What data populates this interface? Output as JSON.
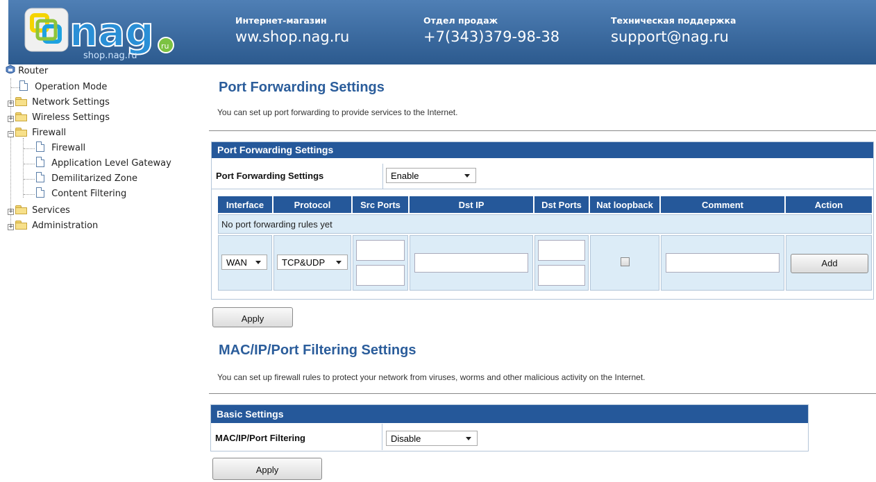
{
  "header": {
    "logo_text": "nag",
    "logo_sub": "shop.nag.ru",
    "logo_badge": "ru",
    "shop_label": "Интернет-магазин",
    "shop_value": "ww.shop.nag.ru",
    "sales_label": "Отдел продаж",
    "sales_value": "+7(343)379-98-38",
    "support_label": "Техническая поддержка",
    "support_value": "support@nag.ru"
  },
  "tree": {
    "root": "Router",
    "operation_mode": "Operation Mode",
    "network_settings": "Network Settings",
    "wireless_settings": "Wireless Settings",
    "firewall": "Firewall",
    "firewall_child": "Firewall",
    "alg": "Application Level Gateway",
    "dmz": "Demilitarized Zone",
    "content_filtering": "Content Filtering",
    "services": "Services",
    "administration": "Administration"
  },
  "port_forwarding": {
    "title": "Port Forwarding Settings",
    "description": "You can set up port forwarding to provide services to the Internet.",
    "box_title": "Port Forwarding Settings",
    "setting_label": "Port Forwarding Settings",
    "setting_value": "Enable",
    "columns": [
      "Interface",
      "Protocol",
      "Src Ports",
      "Dst IP",
      "Dst Ports",
      "Nat loopback",
      "Comment",
      "Action"
    ],
    "empty_text": "No port forwarding rules yet",
    "interface_value": "WAN",
    "protocol_value": "TCP&UDP",
    "add_label": "Add",
    "apply_label": "Apply"
  },
  "mac_filter": {
    "title": "MAC/IP/Port Filtering Settings",
    "description": "You can set up firewall rules to protect your network from viruses, worms and other malicious activity on the Internet.",
    "box_title": "Basic Settings",
    "setting_label": "MAC/IP/Port Filtering",
    "setting_value": "Disable",
    "apply_label": "Apply"
  },
  "colors": {
    "header_bg": "#3b6aa0",
    "title_blue": "#2b5d9b",
    "bar_blue": "#25589a",
    "cell_bg": "#dcecf7"
  }
}
